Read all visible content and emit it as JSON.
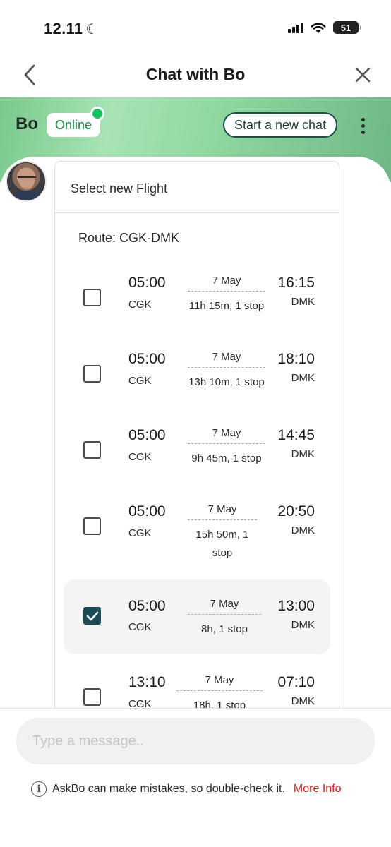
{
  "status_bar": {
    "time": "12.11",
    "battery": "51"
  },
  "header": {
    "title": "Chat with Bo"
  },
  "banner": {
    "bot_name": "Bo",
    "status": "Online",
    "new_chat_label": "Start a new chat"
  },
  "card": {
    "title": "Select new Flight",
    "route": "Route: CGK-DMK",
    "flights": [
      {
        "dep_time": "05:00",
        "dep_code": "CGK",
        "date": "7 May",
        "duration": "11h 15m, 1 stop",
        "arr_time": "16:15",
        "arr_code": "DMK",
        "checked": false
      },
      {
        "dep_time": "05:00",
        "dep_code": "CGK",
        "date": "7 May",
        "duration": "13h 10m, 1 stop",
        "arr_time": "18:10",
        "arr_code": "DMK",
        "checked": false
      },
      {
        "dep_time": "05:00",
        "dep_code": "CGK",
        "date": "7 May",
        "duration": "9h 45m, 1 stop",
        "arr_time": "14:45",
        "arr_code": "DMK",
        "checked": false
      },
      {
        "dep_time": "05:00",
        "dep_code": "CGK",
        "date": "7 May",
        "duration": "15h 50m, 1 stop",
        "arr_time": "20:50",
        "arr_code": "DMK",
        "checked": false
      },
      {
        "dep_time": "05:00",
        "dep_code": "CGK",
        "date": "7 May",
        "duration": "8h, 1 stop",
        "arr_time": "13:00",
        "arr_code": "DMK",
        "checked": true
      },
      {
        "dep_time": "13:10",
        "dep_code": "CGK",
        "date": "7 May",
        "duration": "18h, 1 stop",
        "arr_time": "07:10",
        "arr_code": "DMK",
        "checked": false
      }
    ]
  },
  "composer": {
    "placeholder": "Type a message..",
    "disclaimer": "AskBo can make mistakes, so double-check it.",
    "more_info": "More Info"
  },
  "colors": {
    "accent_green": "#16c060",
    "checkbox_checked": "#1c4a55",
    "link_red": "#d81f1f"
  }
}
